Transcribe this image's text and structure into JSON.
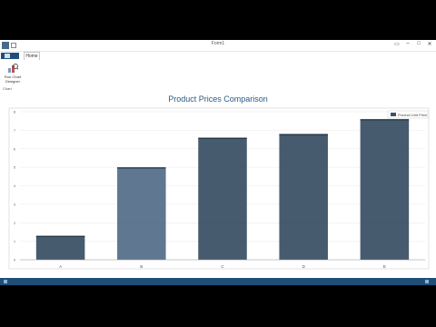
{
  "window": {
    "title": "Form1",
    "tab_home": "Home",
    "ribbon_button_label": "Run Chart Designer",
    "group_label": "Chart"
  },
  "colors": {
    "bar": "#3d5266",
    "bar_highlight": "#56708a",
    "title": "#2b5a85",
    "statusbar": "#1f4e79"
  },
  "chart_data": {
    "type": "bar",
    "title": "Product Prices Comparison",
    "categories": [
      "A",
      "B",
      "C",
      "D",
      "E"
    ],
    "series": [
      {
        "name": "Product Unit Price",
        "values": [
          1.3,
          5.0,
          6.6,
          6.8,
          7.6
        ]
      }
    ],
    "ylim": [
      0,
      8
    ],
    "yticks": [
      "0",
      "1",
      "2",
      "3",
      "4",
      "5",
      "6",
      "7",
      "8"
    ],
    "grid": true,
    "legend": "top-right"
  }
}
